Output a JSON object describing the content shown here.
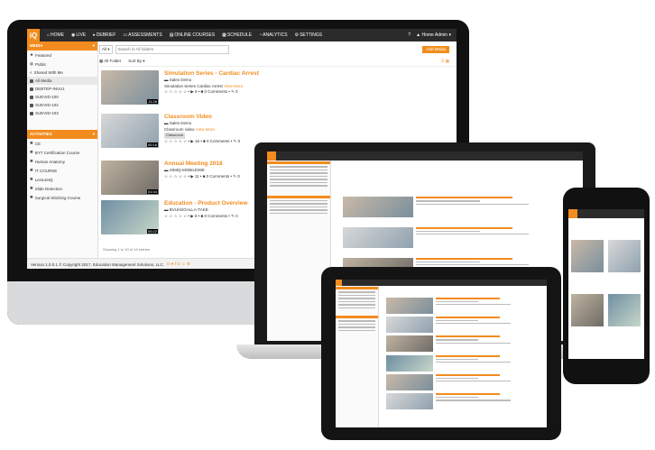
{
  "nav": {
    "logo": "iQ",
    "items": [
      "HOME",
      "LIVE",
      "DEBRIEF",
      "ASSESSMENTS",
      "ONLINE COURSES",
      "SCHEDULE",
      "ANALYTICS",
      "SETTINGS"
    ],
    "help": "?",
    "user": "Home Admin"
  },
  "sidebar": {
    "media_header": "MEDIA",
    "media_items": [
      "Featured",
      "Public",
      "Shared With Me",
      "All Media",
      "DEBTEP-INVU1",
      "SUEVID-100",
      "SUEVID-102",
      "SUEVID-103"
    ],
    "activities_header": "ACTIVITIES",
    "activity_items": [
      "CE",
      "BYT Certification Course",
      "Human Anatomy",
      "IT COURSE",
      "LectureIQ",
      "Slide Detection",
      "Surgical Stitching Course"
    ]
  },
  "filter": {
    "select_value": "All",
    "search_placeholder": "Search in All folders",
    "add_button": "Add Media"
  },
  "toolbar": {
    "folder_label": "All Folder",
    "sort_label": "Sort By"
  },
  "media": [
    {
      "title": "Simulation Series - Cardiac Arrest",
      "folder": "Sales Demo",
      "desc": "Simulation Series Cardiac Arrest",
      "more": "View More",
      "stats": "☆ ☆ ☆ ☆ ☆  •  ▶ 6  •  ■ 0 Comments  •  ✎ 0",
      "duration": "11:26",
      "badge": ""
    },
    {
      "title": "Classroom Video",
      "folder": "Sales Demo",
      "desc": "Classroom video",
      "more": "View More",
      "stats": "☆ ☆ ☆ ☆ ☆  •  ▶ 16  •  ■ 0 Comments  •  ✎ 0",
      "duration": "00:16",
      "badge": "Classroom"
    },
    {
      "title": "Annual Meeting 2018",
      "folder": "SIMIQ-MOBILE008",
      "desc": "",
      "more": "",
      "stats": "☆ ☆ ☆ ☆ ☆  •  ▶ 11  •  ■ 0 Comments  •  ✎ 0",
      "duration": "01:04",
      "badge": ""
    },
    {
      "title": "Education - Product Overview",
      "folder": "BVUHSGALLA-TAKE",
      "desc": "",
      "more": "",
      "stats": "☆ ☆ ☆ ☆ ☆  •  ▶ 8  •  ■ 0 Comments  •  ✎ 0",
      "duration": "00:22",
      "badge": ""
    }
  ],
  "footer": {
    "paging": "Showing 1 to 10 of 19 entries",
    "copyright": "Version 1.0.0.1 © Copyright 2017, Education Management Solutions, LLC.",
    "social": "in ♥ f G ☺ ⚙"
  },
  "colors": {
    "accent": "#f28c1e",
    "nav": "#2b2b2b"
  }
}
